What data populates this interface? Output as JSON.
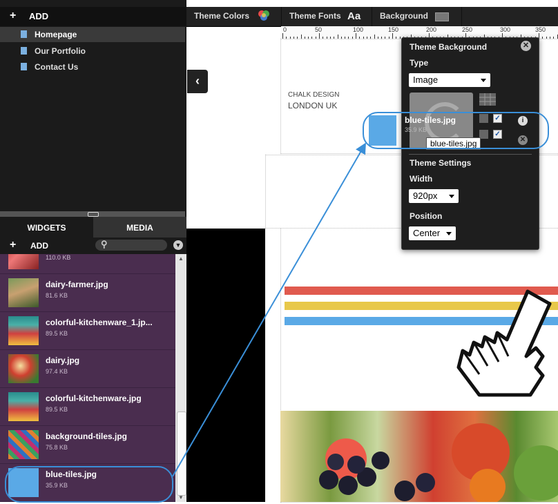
{
  "sidebar": {
    "add_label": "ADD",
    "pages": [
      {
        "label": "Homepage",
        "active": true
      },
      {
        "label": "Our Portfolio",
        "active": false
      },
      {
        "label": "Contact Us",
        "active": false
      }
    ]
  },
  "panel_tabs": {
    "widgets": "WIDGETS",
    "media": "MEDIA",
    "active": "MEDIA"
  },
  "media": {
    "add_label": "ADD",
    "items": [
      {
        "name": "",
        "size": "110.0 KB"
      },
      {
        "name": "dairy-farmer.jpg",
        "size": "81.6 KB"
      },
      {
        "name": "colorful-kitchenware_1.jp...",
        "size": "89.5 KB"
      },
      {
        "name": "dairy.jpg",
        "size": "97.4 KB"
      },
      {
        "name": "colorful-kitchenware.jpg",
        "size": "89.5 KB"
      },
      {
        "name": "background-tiles.jpg",
        "size": "75.8 KB"
      },
      {
        "name": "blue-tiles.jpg",
        "size": "35.9 KB"
      }
    ]
  },
  "toolbar": {
    "theme_colors": "Theme Colors",
    "theme_fonts": "Theme Fonts",
    "fonts_glyph": "Aa",
    "background": "Background"
  },
  "ruler": {
    "labels": [
      "0",
      "50",
      "100",
      "150",
      "200",
      "250",
      "300",
      "350"
    ]
  },
  "canvas": {
    "site_title": "CHALK DESIGN",
    "site_subtitle": "LONDON UK",
    "stripe_colors": [
      "#e05a4e",
      "#e8c84a",
      "#5aa9e6"
    ]
  },
  "popup": {
    "title": "Theme Background",
    "type_label": "Type",
    "type_value": "Image",
    "image_name": "blue-tiles.jpg",
    "image_size": "35.9 KB",
    "tooltip": "blue-tiles.jpg",
    "settings_label": "Theme Settings",
    "width_label": "Width",
    "width_value": "920px",
    "position_label": "Position",
    "position_value": "Center"
  },
  "colors": {
    "accent_blue": "#3a8fd8",
    "media_bg": "#4a2d4f",
    "tile_blue": "#5aa9e6"
  }
}
